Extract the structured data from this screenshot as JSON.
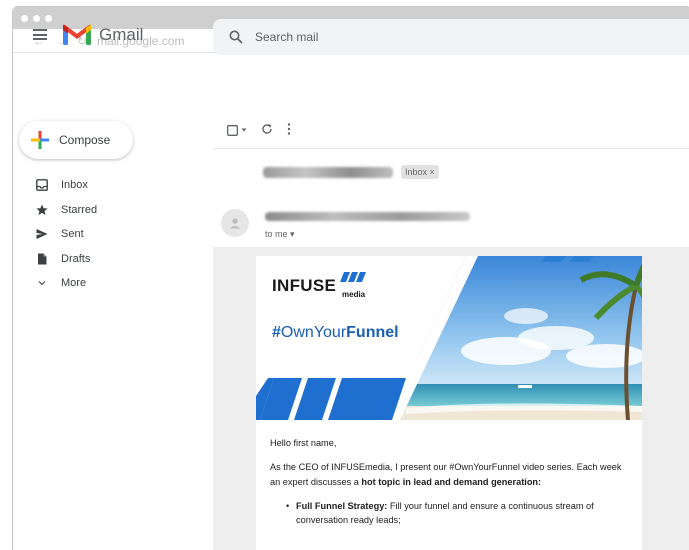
{
  "browser": {
    "url": "mail.google.com",
    "nav_back": "←",
    "nav_forward": "→",
    "nav_reload": "↻"
  },
  "gmail": {
    "logo_text": "Gmail",
    "search_placeholder": "Search mail"
  },
  "sidebar": {
    "compose_label": "Compose",
    "items": [
      {
        "label": "Inbox",
        "icon": "inbox-icon"
      },
      {
        "label": "Starred",
        "icon": "star-icon"
      },
      {
        "label": "Sent",
        "icon": "send-icon"
      },
      {
        "label": "Drafts",
        "icon": "draft-icon"
      },
      {
        "label": "More",
        "icon": "chevron-down-icon"
      }
    ]
  },
  "toolbar": {
    "select_icon": "checkbox-icon",
    "refresh_icon": "refresh-icon",
    "more_icon": "more-vert-icon"
  },
  "thread": {
    "label_chip": "Inbox ×",
    "recipient": "to me ▾"
  },
  "email": {
    "brand": "INFUSE",
    "brand_sub": "media",
    "hashtag_prefix": "#",
    "hashtag_own": "Own",
    "hashtag_your": "Your",
    "hashtag_funnel": "Funnel",
    "greeting": "Hello first name,",
    "intro_1": "As the CEO of INFUSEmedia, I present our #OwnYourFunnel video series. Each week an expert discusses a ",
    "intro_bold": "hot topic in lead and demand generation:",
    "bullets": [
      {
        "bold": "Full Funnel Strategy:",
        "text": " Fill your funnel and ensure a continuous stream of conversation ready leads;"
      }
    ]
  },
  "colors": {
    "brand_blue": "#1b5fb4",
    "accent_blue": "#2d7fd4",
    "gmail_red": "#ea4335"
  }
}
